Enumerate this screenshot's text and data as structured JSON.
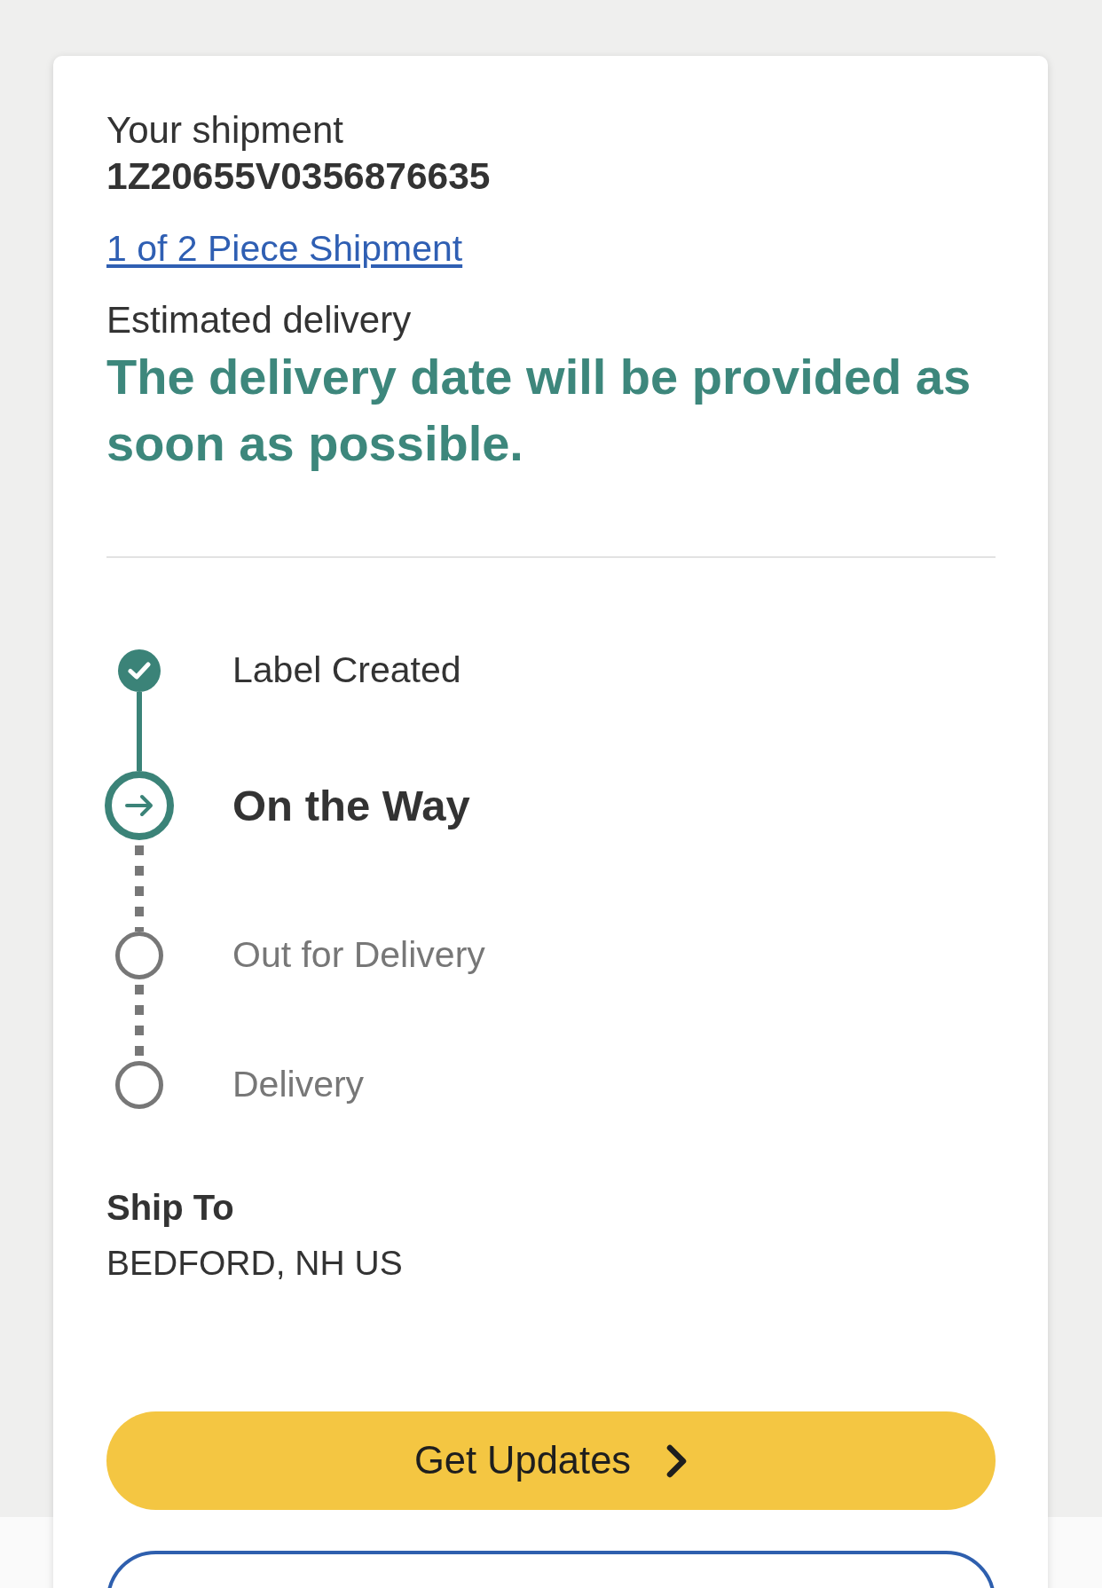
{
  "shipment": {
    "label": "Your shipment",
    "tracking_number": "1Z20655V0356876635",
    "piece_link": "1 of 2 Piece Shipment"
  },
  "estimated_delivery": {
    "label": "Estimated delivery",
    "message": "The delivery date will be provided as soon as possible."
  },
  "progress": [
    {
      "label": "Label Created",
      "completed": true,
      "current": false
    },
    {
      "label": "On the Way",
      "completed": false,
      "current": true
    },
    {
      "label": "Out for Delivery",
      "completed": false,
      "current": false
    },
    {
      "label": "Delivery",
      "completed": false,
      "current": false
    }
  ],
  "ship_to": {
    "label": "Ship To",
    "address": "BEDFORD, NH US"
  },
  "buttons": [
    {
      "label": "Get Updates",
      "kind": "primary"
    },
    {
      "kind": "outline"
    }
  ]
}
